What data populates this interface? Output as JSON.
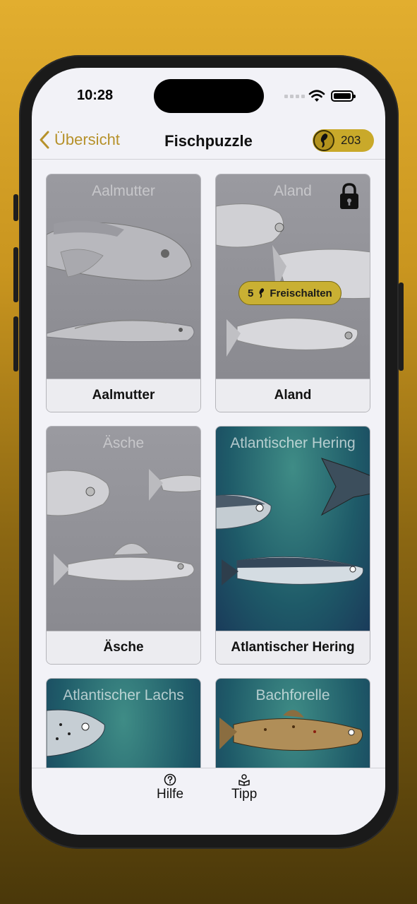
{
  "status_bar": {
    "time": "10:28"
  },
  "nav": {
    "back_label": "Übersicht",
    "title": "Fischpuzzle",
    "coin_count": "203"
  },
  "puzzles": [
    {
      "art_title": "Aalmutter",
      "label": "Aalmutter",
      "locked": false,
      "style": "gray"
    },
    {
      "art_title": "Aland",
      "label": "Aland",
      "locked": true,
      "style": "gray",
      "unlock_cost": "5",
      "unlock_label": "Freischalten"
    },
    {
      "art_title": "Äsche",
      "label": "Äsche",
      "locked": false,
      "style": "gray"
    },
    {
      "art_title": "Atlantischer Hering",
      "label": "Atlantischer Hering",
      "locked": false,
      "style": "teal"
    },
    {
      "art_title": "Atlantischer Lachs",
      "label": "",
      "locked": false,
      "style": "teal"
    },
    {
      "art_title": "Bachforelle",
      "label": "",
      "locked": false,
      "style": "teal"
    }
  ],
  "tabbar": {
    "help_label": "Hilfe",
    "tip_label": "Tipp"
  },
  "colors": {
    "accent": "#b6912a",
    "coin_badge": "#c9a92a",
    "background_gradient_top": "#e2ae2f",
    "background_gradient_bottom": "#4a380a",
    "teal_card": "#1e5a68"
  }
}
